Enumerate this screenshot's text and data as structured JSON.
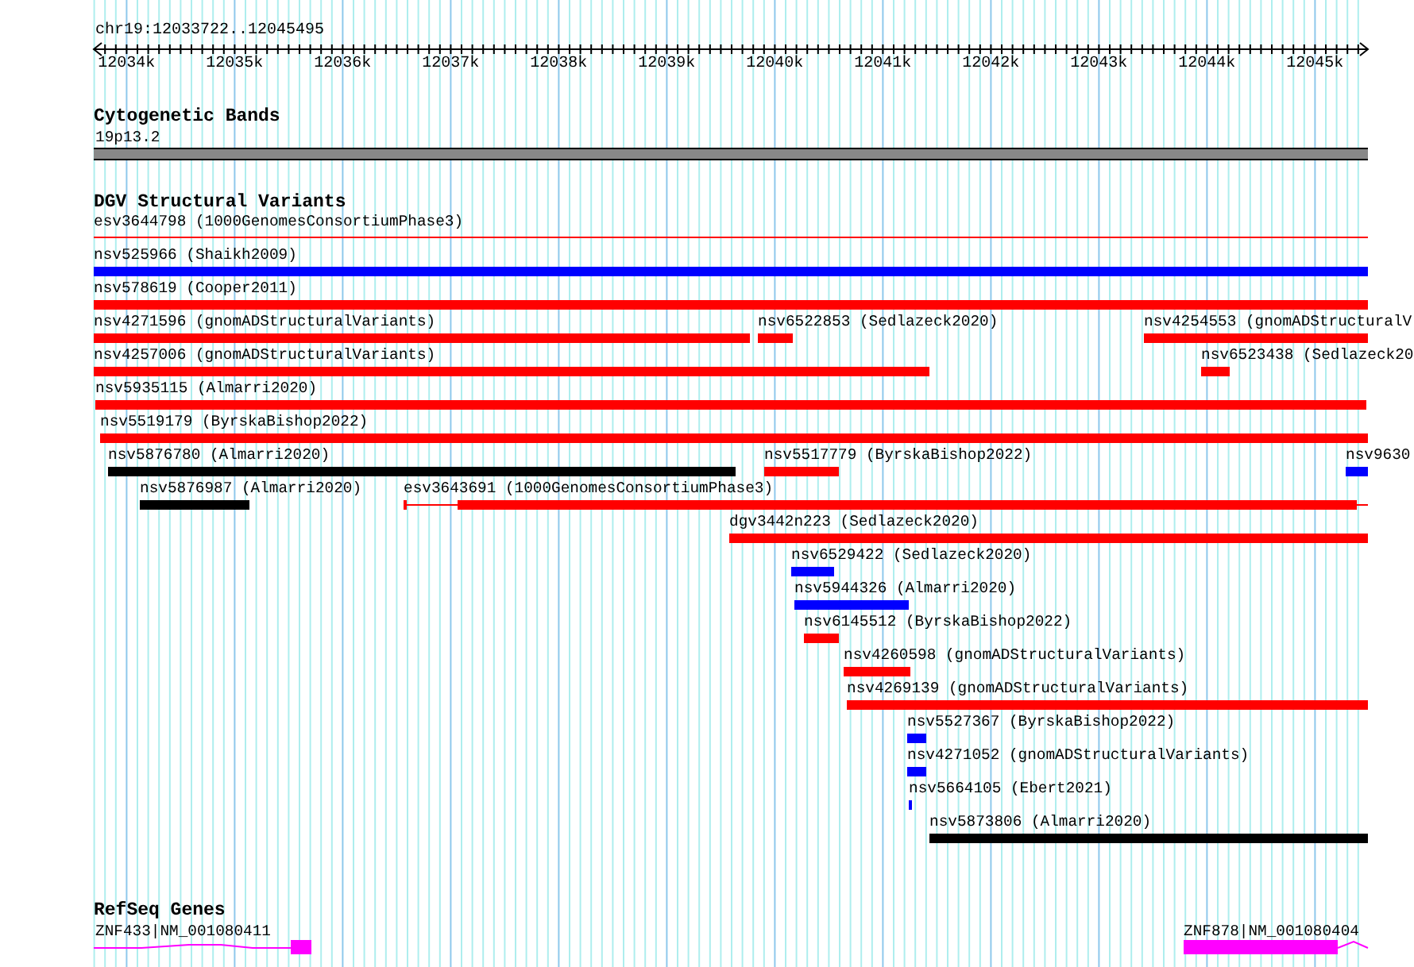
{
  "ruler": {
    "location": "chr19:12033722..12045495",
    "ticks": [
      "12034k",
      "12035k",
      "12036k",
      "12037k",
      "12038k",
      "12039k",
      "12040k",
      "12041k",
      "12042k",
      "12043k",
      "12044k",
      "12045k"
    ]
  },
  "tracks": [
    {
      "title": "Cytogenetic Bands",
      "kind": "bands",
      "features": [
        {
          "label": "19p13.2",
          "color": "#888888"
        }
      ]
    },
    {
      "title": "DGV Structural Variants",
      "kind": "variants",
      "features": [
        {
          "label": "esv3644798 (1000GenomesConsortiumPhase3)",
          "kind": "line",
          "color": "#ff0000"
        },
        {
          "label": "nsv525966 (Shaikh2009)",
          "kind": "bar",
          "color": "#0000ff"
        },
        {
          "label": "nsv578619 (Cooper2011)",
          "kind": "bar",
          "color": "#ff0000"
        },
        {
          "label": "nsv4271596 (gnomADStructuralVariants)",
          "kind": "bar",
          "color": "#ff0000"
        },
        {
          "label": "nsv6522853 (Sedlazeck2020)",
          "kind": "bar",
          "color": "#ff0000"
        },
        {
          "label": "nsv4254553 (gnomADStructuralV",
          "kind": "bar",
          "color": "#ff0000"
        },
        {
          "label": "nsv4257006 (gnomADStructuralVariants)",
          "kind": "bar",
          "color": "#ff0000"
        },
        {
          "label": "nsv6523438 (Sedlazeck20",
          "kind": "bar",
          "color": "#ff0000"
        },
        {
          "label": "nsv5935115 (Almarri2020)",
          "kind": "bar",
          "color": "#ff0000"
        },
        {
          "label": "nsv5519179 (ByrskaBishop2022)",
          "kind": "bar",
          "color": "#ff0000"
        },
        {
          "label": "nsv5876780 (Almarri2020)",
          "kind": "bar",
          "color": "#000000"
        },
        {
          "label": "nsv5517779 (ByrskaBishop2022)",
          "kind": "bar",
          "color": "#ff0000"
        },
        {
          "label": "nsv9630",
          "kind": "bar",
          "color": "#0000ff"
        },
        {
          "label": "nsv5876987 (Almarri2020)",
          "kind": "bar",
          "color": "#000000"
        },
        {
          "label": "esv3643691 (1000GenomesConsortiumPhase3)",
          "kind": "split",
          "color": "#ff0000"
        },
        {
          "label": "dgv3442n223 (Sedlazeck2020)",
          "kind": "bar",
          "color": "#ff0000"
        },
        {
          "label": "nsv6529422 (Sedlazeck2020)",
          "kind": "bar",
          "color": "#0000ff"
        },
        {
          "label": "nsv5944326 (Almarri2020)",
          "kind": "bar",
          "color": "#0000ff"
        },
        {
          "label": "nsv6145512 (ByrskaBishop2022)",
          "kind": "bar",
          "color": "#ff0000"
        },
        {
          "label": "nsv4260598 (gnomADStructuralVariants)",
          "kind": "bar",
          "color": "#ff0000"
        },
        {
          "label": "nsv4269139 (gnomADStructuralVariants)",
          "kind": "bar",
          "color": "#ff0000"
        },
        {
          "label": "nsv5527367 (ByrskaBishop2022)",
          "kind": "bar",
          "color": "#0000ff"
        },
        {
          "label": "nsv4271052 (gnomADStructuralVariants)",
          "kind": "bar",
          "color": "#0000ff"
        },
        {
          "label": "nsv5664105 (Ebert2021)",
          "kind": "bar",
          "color": "#0000ff"
        },
        {
          "label": "nsv5873806 (Almarri2020)",
          "kind": "bar",
          "color": "#000000"
        }
      ]
    },
    {
      "title": "RefSeq Genes",
      "kind": "genes",
      "features": [
        {
          "label": "ZNF433|NM_001080411",
          "kind": "gene-left",
          "color": "#ff00ff"
        },
        {
          "label": "ZNF878|NM_001080404",
          "kind": "gene-right",
          "color": "#ff00ff"
        }
      ]
    }
  ]
}
